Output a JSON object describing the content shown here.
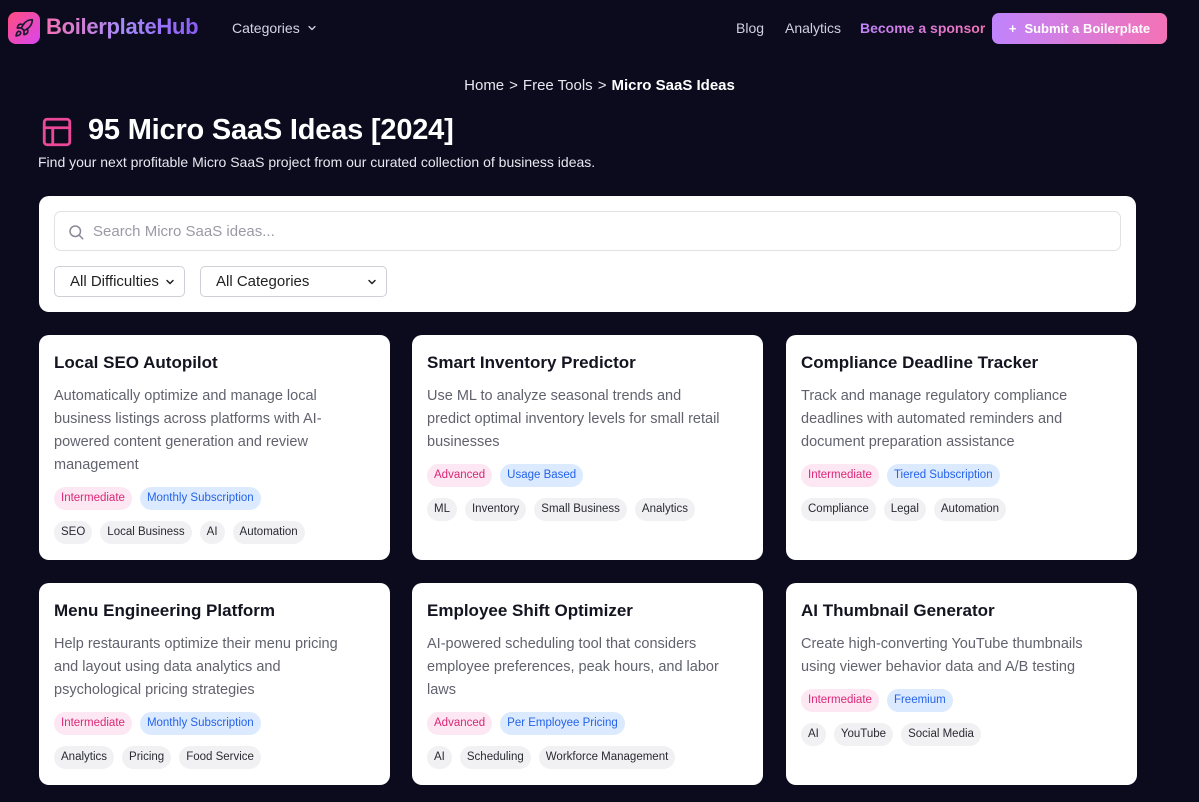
{
  "header": {
    "brand": "BoilerplateHub",
    "categories_label": "Categories",
    "blog_label": "Blog",
    "analytics_label": "Analytics",
    "sponsor_label": "Become a sponsor",
    "submit_label": "Submit a Boilerplate"
  },
  "breadcrumb": {
    "home": "Home",
    "separator": ">",
    "free_tools": "Free Tools",
    "current": "Micro SaaS Ideas"
  },
  "page": {
    "title": "95 Micro SaaS Ideas [2024]",
    "subtitle": "Find your next profitable Micro SaaS project from our curated collection of business ideas."
  },
  "filters": {
    "search_placeholder": "Search Micro SaaS ideas...",
    "difficulty_value": "All Difficulties",
    "category_value": "All Categories"
  },
  "ideas": [
    {
      "title": "Local SEO Autopilot",
      "description": "Automatically optimize and manage local business listings across platforms with AI-powered content generation and review management",
      "difficulty": "Intermediate",
      "pricing": "Monthly Subscription",
      "tags": [
        "SEO",
        "Local Business",
        "AI",
        "Automation"
      ]
    },
    {
      "title": "Smart Inventory Predictor",
      "description": "Use ML to analyze seasonal trends and predict optimal inventory levels for small retail businesses",
      "difficulty": "Advanced",
      "pricing": "Usage Based",
      "tags": [
        "ML",
        "Inventory",
        "Small Business",
        "Analytics"
      ]
    },
    {
      "title": "Compliance Deadline Tracker",
      "description": "Track and manage regulatory compliance deadlines with automated reminders and document preparation assistance",
      "difficulty": "Intermediate",
      "pricing": "Tiered Subscription",
      "tags": [
        "Compliance",
        "Legal",
        "Automation"
      ]
    },
    {
      "title": "Menu Engineering Platform",
      "description": "Help restaurants optimize their menu pricing and layout using data analytics and psychological pricing strategies",
      "difficulty": "Intermediate",
      "pricing": "Monthly Subscription",
      "tags": [
        "Analytics",
        "Pricing",
        "Food Service"
      ]
    },
    {
      "title": "Employee Shift Optimizer",
      "description": "AI-powered scheduling tool that considers employee preferences, peak hours, and labor laws",
      "difficulty": "Advanced",
      "pricing": "Per Employee Pricing",
      "tags": [
        "AI",
        "Scheduling",
        "Workforce Management"
      ]
    },
    {
      "title": "AI Thumbnail Generator",
      "description": "Create high-converting YouTube thumbnails using viewer behavior data and A/B testing",
      "difficulty": "Intermediate",
      "pricing": "Freemium",
      "tags": [
        "AI",
        "YouTube",
        "Social Media"
      ]
    }
  ]
}
